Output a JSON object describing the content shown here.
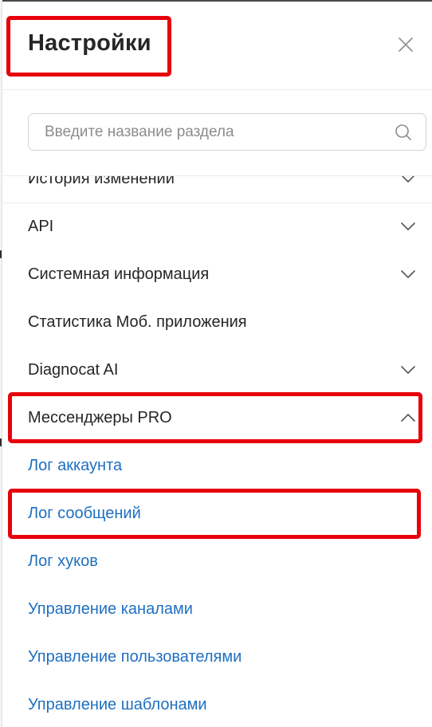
{
  "panel": {
    "title": "Настройки",
    "close_icon": "close-icon"
  },
  "search": {
    "placeholder": "Введите название раздела",
    "value": "",
    "icon": "search-icon"
  },
  "menu": {
    "items": [
      {
        "label": "История изменений",
        "expandable": true,
        "expanded": false,
        "partially_visible": true
      },
      {
        "label": "API",
        "expandable": true,
        "expanded": false
      },
      {
        "label": "Системная информация",
        "expandable": true,
        "expanded": false
      },
      {
        "label": "Статистика Моб. приложения",
        "expandable": false
      },
      {
        "label": "Diagnocat AI",
        "expandable": true,
        "expanded": false
      },
      {
        "label": "Мессенджеры PRO",
        "expandable": true,
        "expanded": true,
        "highlighted": true
      }
    ],
    "subitems": [
      {
        "label": "Лог аккаунта"
      },
      {
        "label": "Лог сообщений",
        "highlighted": true
      },
      {
        "label": "Лог хуков"
      },
      {
        "label": "Управление каналами"
      },
      {
        "label": "Управление пользователями"
      },
      {
        "label": "Управление шаблонами"
      }
    ]
  },
  "colors": {
    "link": "#1f6fc1",
    "text": "#262626",
    "highlight": "#e8000b"
  }
}
